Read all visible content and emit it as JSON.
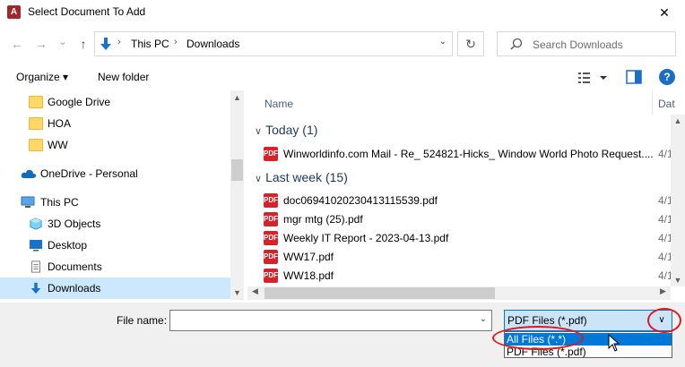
{
  "window": {
    "title": "Select Document To Add",
    "app_icon_letter": "A",
    "close_glyph": "✕"
  },
  "nav": {
    "back_glyph": "←",
    "forward_glyph": "→",
    "recent_glyph": "⌄",
    "up_glyph": "↑",
    "breadcrumb": [
      "This PC",
      "Downloads"
    ],
    "breadcrumb_sep": "›",
    "refresh_glyph": "↻",
    "search_placeholder": "Search Downloads"
  },
  "toolbar": {
    "organize_label": "Organize ▾",
    "new_folder_label": "New folder",
    "help_glyph": "?"
  },
  "sidebar": {
    "items": [
      {
        "label": "Google Drive",
        "icon": "folder-icon"
      },
      {
        "label": "HOA",
        "icon": "folder-icon"
      },
      {
        "label": "WW",
        "icon": "folder-icon"
      },
      {
        "label": "OneDrive - Personal",
        "icon": "cloud-icon"
      },
      {
        "label": "This PC",
        "icon": "computer-icon"
      },
      {
        "label": "3D Objects",
        "icon": "cube-icon"
      },
      {
        "label": "Desktop",
        "icon": "desktop-icon"
      },
      {
        "label": "Documents",
        "icon": "document-icon"
      },
      {
        "label": "Downloads",
        "icon": "download-icon",
        "selected": true
      }
    ]
  },
  "files": {
    "col_name": "Name",
    "col_date": "Dat",
    "groups": [
      {
        "label": "Today (1)",
        "files": [
          {
            "name": "Winworldinfo.com Mail - Re_ 524821-Hicks_ Window World Photo Request....",
            "date": "4/1"
          }
        ]
      },
      {
        "label": "Last week (15)",
        "files": [
          {
            "name": "doc06941020230413115539.pdf",
            "date": "4/1"
          },
          {
            "name": "mgr mtg (25).pdf",
            "date": "4/1"
          },
          {
            "name": "Weekly IT Report - 2023-04-13.pdf",
            "date": "4/1"
          },
          {
            "name": "WW17.pdf",
            "date": "4/1"
          },
          {
            "name": "WW18.pdf",
            "date": "4/1"
          }
        ]
      }
    ]
  },
  "bottom": {
    "file_name_label": "File name:",
    "file_name_value": "",
    "file_type_selected": "PDF Files (*.pdf)",
    "file_type_options": [
      "All Files (*.*)",
      "PDF Files (*.pdf)"
    ],
    "highlighted_option": 0
  },
  "colors": {
    "accent": "#0078d7",
    "annotation": "#e0181c",
    "selected": "#cce8ff"
  }
}
